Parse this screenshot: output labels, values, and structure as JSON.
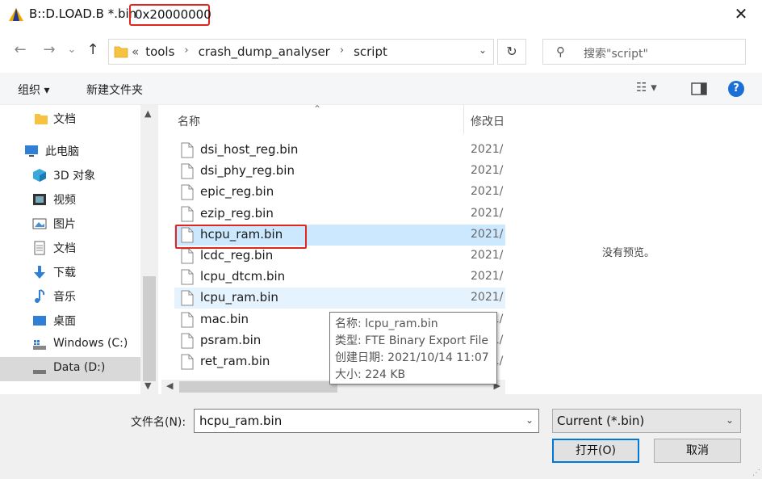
{
  "window": {
    "title": "B::D.LOAD.B *.bin",
    "title_highlight": "0x20000000",
    "close_glyph": "✕"
  },
  "address": {
    "back_glyph": "←",
    "forward_glyph": "→",
    "recent_glyph": "⌄",
    "up_glyph": "↑",
    "overflow": "«",
    "breadcrumbs": [
      "tools",
      "crash_dump_analyser",
      "script"
    ],
    "refresh_glyph": "↻"
  },
  "search": {
    "placeholder": "搜索\"script\""
  },
  "toolbar": {
    "organize": "组织 ▾",
    "new_folder": "新建文件夹"
  },
  "nav": {
    "items": [
      {
        "label": "文档",
        "icon": "folder-icon"
      },
      {
        "label": "此电脑",
        "icon": "computer-icon"
      },
      {
        "label": "3D 对象",
        "icon": "3d-objects-icon"
      },
      {
        "label": "视频",
        "icon": "video-icon"
      },
      {
        "label": "图片",
        "icon": "pictures-icon"
      },
      {
        "label": "文档",
        "icon": "documents-icon"
      },
      {
        "label": "下载",
        "icon": "download-icon"
      },
      {
        "label": "音乐",
        "icon": "music-icon"
      },
      {
        "label": "桌面",
        "icon": "desktop-icon"
      },
      {
        "label": "Windows (C:)",
        "icon": "drive-icon"
      },
      {
        "label": "Data (D:)",
        "icon": "drive-icon"
      }
    ]
  },
  "filelist": {
    "col_name": "名称",
    "col_date": "修改日",
    "files": [
      {
        "name": "dsi_host_reg.bin",
        "date": "2021/"
      },
      {
        "name": "dsi_phy_reg.bin",
        "date": "2021/"
      },
      {
        "name": "epic_reg.bin",
        "date": "2021/"
      },
      {
        "name": "ezip_reg.bin",
        "date": "2021/"
      },
      {
        "name": "hcpu_ram.bin",
        "date": "2021/"
      },
      {
        "name": "lcdc_reg.bin",
        "date": "2021/"
      },
      {
        "name": "lcpu_dtcm.bin",
        "date": "2021/"
      },
      {
        "name": "lcpu_ram.bin",
        "date": "2021/"
      },
      {
        "name": "mac.bin",
        "date": "2021/"
      },
      {
        "name": "psram.bin",
        "date": "2021/"
      },
      {
        "name": "ret_ram.bin",
        "date": "2021/"
      }
    ],
    "selected_index": 4,
    "hover_index": 7
  },
  "tooltip": {
    "name": "名称: lcpu_ram.bin",
    "type": "类型: FTE Binary Export File",
    "created": "创建日期: 2021/10/14 11:07",
    "size": "大小: 224 KB"
  },
  "preview": {
    "text": "没有预览。"
  },
  "bottom": {
    "filename_label": "文件名(N):",
    "filename_value": "hcpu_ram.bin",
    "filter_value": "Current (*.bin)",
    "open_label": "打开(O)",
    "cancel_label": "取消"
  },
  "colors": {
    "accent": "#0078d7",
    "highlight_box": "#e0261f",
    "selection": "#cce8ff",
    "hover": "#e5f3ff"
  }
}
